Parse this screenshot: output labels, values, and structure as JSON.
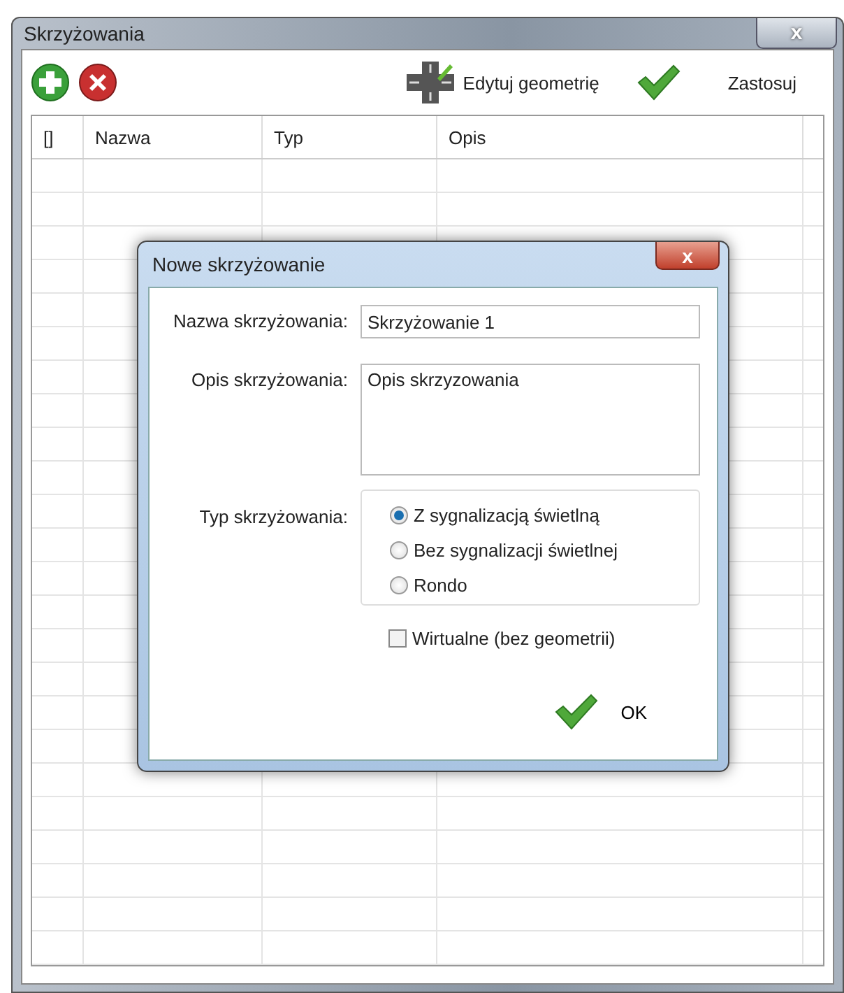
{
  "window": {
    "title": "Skrzyżowania",
    "close": "x"
  },
  "toolbar": {
    "edit_label": "Edytuj geometrię",
    "apply_label": "Zastosuj"
  },
  "table": {
    "columns": [
      "[]",
      "Nazwa",
      "Typ",
      "Opis"
    ]
  },
  "dialog": {
    "title": "Nowe skrzyżowanie",
    "close": "x",
    "name_label": "Nazwa skrzyżowania:",
    "name_value": "Skrzyżowanie 1",
    "desc_label": "Opis skrzyżowania:",
    "desc_value": "Opis skrzyzowania",
    "type_label": "Typ skrzyżowania:",
    "types": [
      {
        "label": "Z sygnalizacją świetlną",
        "selected": true
      },
      {
        "label": "Bez sygnalizacji świetlnej",
        "selected": false
      },
      {
        "label": "Rondo",
        "selected": false
      }
    ],
    "virtual": {
      "label": "Wirtualne (bez geometrii)",
      "checked": false
    },
    "ok": "OK"
  }
}
